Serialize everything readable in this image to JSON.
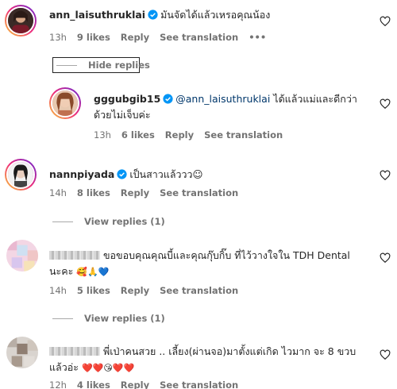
{
  "comments": [
    {
      "username": "ann_laisuthruklai",
      "text": "มันจัดได้แล้วเหรอคุณน้อง",
      "time": "13h",
      "likes": "9 likes",
      "reply": "Reply",
      "translate": "See translation",
      "more": "•••",
      "hide_replies": "Hide replies"
    },
    {
      "username": "gggubgib15",
      "mention": "@ann_laisuthruklai",
      "text_line1": "ได้แล้วแม่และดีกว่า",
      "text_line2": "ด้วยไม่เจ็บค่ะ",
      "time": "13h",
      "likes": "6 likes",
      "reply": "Reply",
      "translate": "See translation"
    },
    {
      "username": "nannpiyada",
      "text": "เป็นสาวแล้ววว☺",
      "time": "14h",
      "likes": "8 likes",
      "reply": "Reply",
      "translate": "See translation",
      "view_replies": "View replies (1)"
    },
    {
      "text_line1": "ขอขอบคุณคุณบี้และคุณกุ๊บกิ๊บ ที่ไว้วางใจใน TDH Dental",
      "text_line2": "นะคะ",
      "emojis": "🥰🙏💙",
      "time": "14h",
      "likes": "5 likes",
      "reply": "Reply",
      "translate": "See translation",
      "view_replies": "View replies (1)"
    },
    {
      "text_line1": "พี่เป่าคนสวย .. เลี้ยง(ผ่านจอ)มาตั้งแต่เกิด ไวมาก จะ 8 ขวบ",
      "text_line2": "แล้วอ่ะ",
      "emojis": "❤️❤️😘❤️❤️",
      "time": "12h",
      "likes": "4 likes",
      "reply": "Reply",
      "translate": "See translation"
    }
  ],
  "colors": {
    "verified": "#0095f6",
    "mention": "#00376b",
    "meta": "#737373"
  },
  "icons": [
    "heart-icon",
    "verified-badge-icon"
  ]
}
